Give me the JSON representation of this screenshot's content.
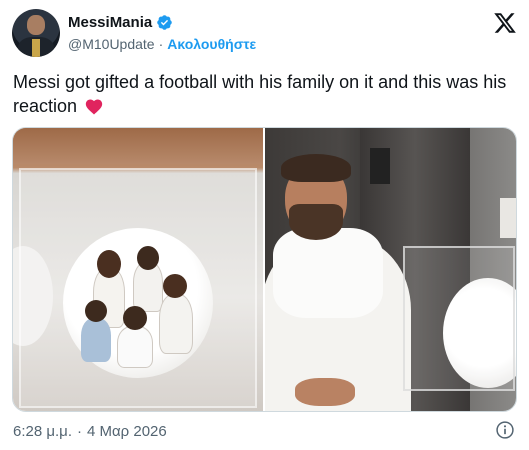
{
  "author": {
    "display_name": "MessiMania",
    "handle": "@M10Update",
    "follow_label": "Ακολουθήστε",
    "separator": "·"
  },
  "tweet": {
    "text": "Messi got gifted a football with his family on it and this was his reaction"
  },
  "footer": {
    "time": "6:28 μ.μ.",
    "separator": "·",
    "date": "4 Μαρ 2026"
  },
  "icons": {
    "verified": "verified-badge-icon",
    "brand": "x-logo-icon",
    "emoji": "red-heart-icon",
    "info": "info-icon"
  },
  "colors": {
    "verified_blue": "#1d9bf0",
    "follow_blue": "#1d9bf0",
    "secondary_text": "#536471",
    "heart_red": "#e0245e",
    "border": "#cfd9de"
  }
}
